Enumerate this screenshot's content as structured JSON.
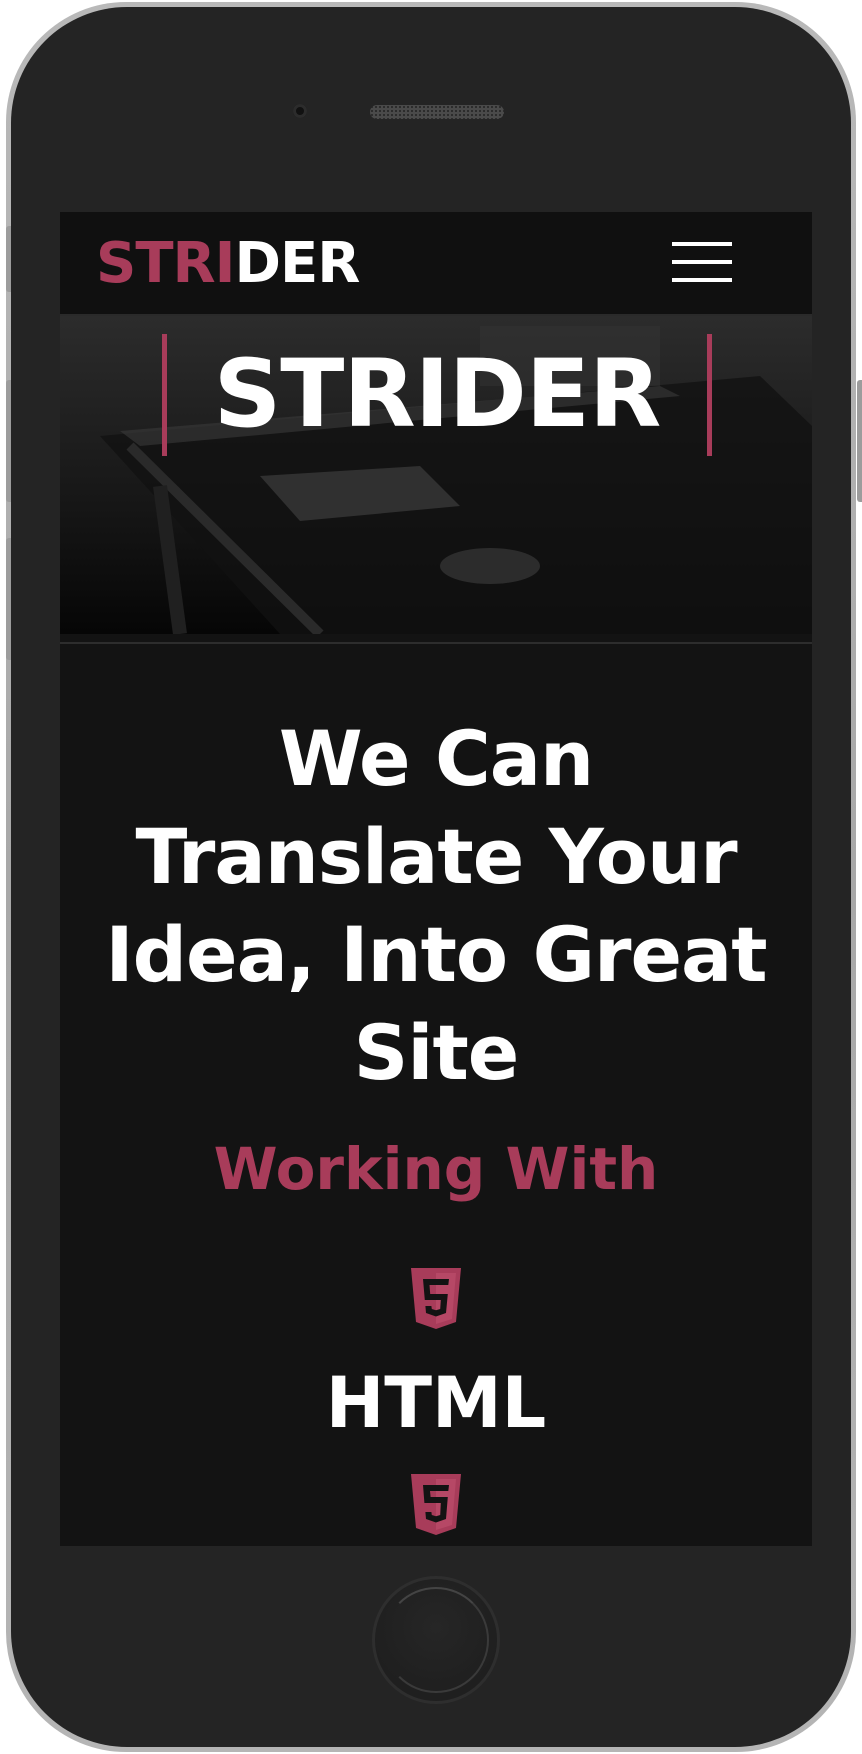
{
  "navbar": {
    "logo_part1": "STRI",
    "logo_part2": "DER",
    "menu_icon": "hamburger-menu-icon"
  },
  "hero": {
    "title": "STRIDER",
    "background": "dark desk workspace photo"
  },
  "content": {
    "headline": "We Can Translate Your Idea, Into Great Site",
    "subheading": "Working With",
    "technologies": [
      {
        "icon": "html5-icon",
        "label": "HTML"
      },
      {
        "icon": "css3-icon",
        "label": ""
      }
    ]
  },
  "colors": {
    "accent": "#a83c5a",
    "background": "#131313",
    "text": "#ffffff"
  }
}
